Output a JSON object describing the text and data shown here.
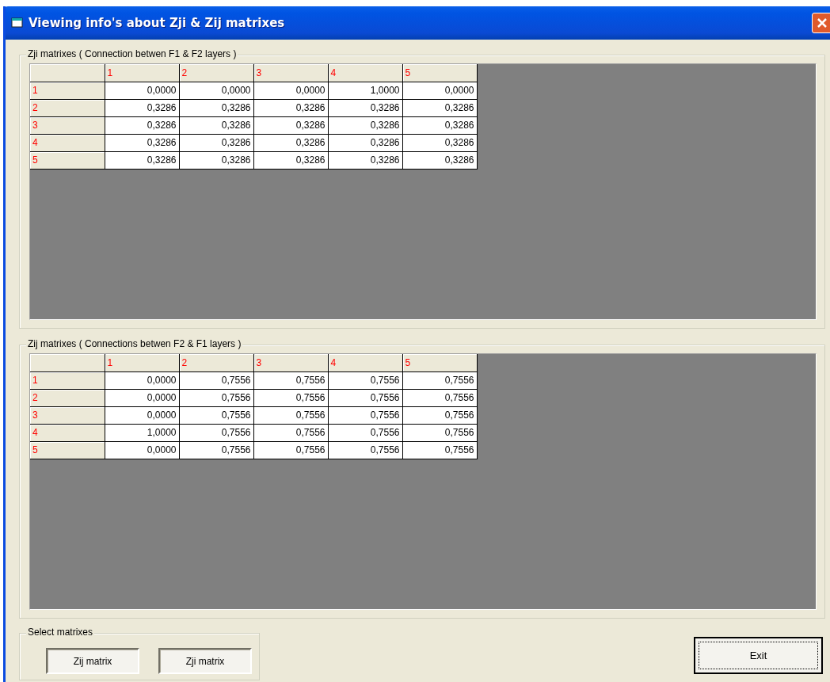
{
  "window": {
    "title": "Viewing info's about Zji & Zij matrixes"
  },
  "frames": [
    {
      "title": "Zji matrixes ( Connection betwen F1 & F2 layers )",
      "columns": [
        "1",
        "2",
        "3",
        "4",
        "5"
      ],
      "rows": [
        {
          "label": "1",
          "cells": [
            "0,0000",
            "0,0000",
            "0,0000",
            "1,0000",
            "0,0000"
          ]
        },
        {
          "label": "2",
          "cells": [
            "0,3286",
            "0,3286",
            "0,3286",
            "0,3286",
            "0,3286"
          ]
        },
        {
          "label": "3",
          "cells": [
            "0,3286",
            "0,3286",
            "0,3286",
            "0,3286",
            "0,3286"
          ]
        },
        {
          "label": "4",
          "cells": [
            "0,3286",
            "0,3286",
            "0,3286",
            "0,3286",
            "0,3286"
          ]
        },
        {
          "label": "5",
          "cells": [
            "0,3286",
            "0,3286",
            "0,3286",
            "0,3286",
            "0,3286"
          ]
        }
      ]
    },
    {
      "title": "Zij matrixes ( Connections betwen F2 & F1 layers )",
      "columns": [
        "1",
        "2",
        "3",
        "4",
        "5"
      ],
      "rows": [
        {
          "label": "1",
          "cells": [
            "0,0000",
            "0,7556",
            "0,7556",
            "0,7556",
            "0,7556"
          ]
        },
        {
          "label": "2",
          "cells": [
            "0,0000",
            "0,7556",
            "0,7556",
            "0,7556",
            "0,7556"
          ]
        },
        {
          "label": "3",
          "cells": [
            "0,0000",
            "0,7556",
            "0,7556",
            "0,7556",
            "0,7556"
          ]
        },
        {
          "label": "4",
          "cells": [
            "1,0000",
            "0,7556",
            "0,7556",
            "0,7556",
            "0,7556"
          ]
        },
        {
          "label": "5",
          "cells": [
            "0,0000",
            "0,7556",
            "0,7556",
            "0,7556",
            "0,7556"
          ]
        }
      ]
    }
  ],
  "select": {
    "title": "Select matrixes",
    "buttons": [
      "Zij matrix",
      "Zji matrix"
    ]
  },
  "exit_button": "Exit"
}
